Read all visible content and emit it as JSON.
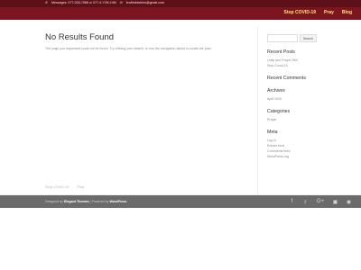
{
  "topbar": {
    "phone_icon": "phone-icon",
    "contact_text": "Messages: 077-026-7988 or 077-4-YOK-HIM",
    "email_icon": "mail-icon",
    "email": "kraftministries@gmail.com"
  },
  "nav": {
    "items": [
      {
        "label": "Stop COVID-19"
      },
      {
        "label": "Pray"
      },
      {
        "label": "Blog"
      }
    ]
  },
  "main": {
    "title": "No Results Found",
    "message": "The page you requested could not be found. Try refining your search, or use the navigation above to locate the post."
  },
  "sidebar": {
    "search_placeholder": "",
    "search_button": "Search",
    "recent_posts_title": "Recent Posts",
    "recent_posts": [
      "Unity and Prayer Will Stop Covid-19"
    ],
    "recent_comments_title": "Recent Comments",
    "archives_title": "Archives",
    "archives": [
      "April 2020"
    ],
    "categories_title": "Categories",
    "categories": [
      "Prayer"
    ],
    "meta_title": "Meta",
    "meta": [
      "Log in",
      "Entries feed",
      "Comments feed",
      "WordPress.org"
    ]
  },
  "footer_links": [
    "Stop COVID-19",
    "Pray"
  ],
  "footer": {
    "credit_prefix": "Designed by",
    "credit_theme": "Elegant Themes",
    "credit_mid": "| Powered by",
    "credit_wp": "WordPress",
    "social_icons": [
      "facebook-icon",
      "twitter-icon",
      "google-plus-icon",
      "instagram-icon",
      "rss-icon"
    ]
  },
  "colors": {
    "topbar": "#5e1018",
    "navbar": "#7b1620",
    "nav_text": "#ffe36a",
    "footer": "#6b6b6b"
  }
}
